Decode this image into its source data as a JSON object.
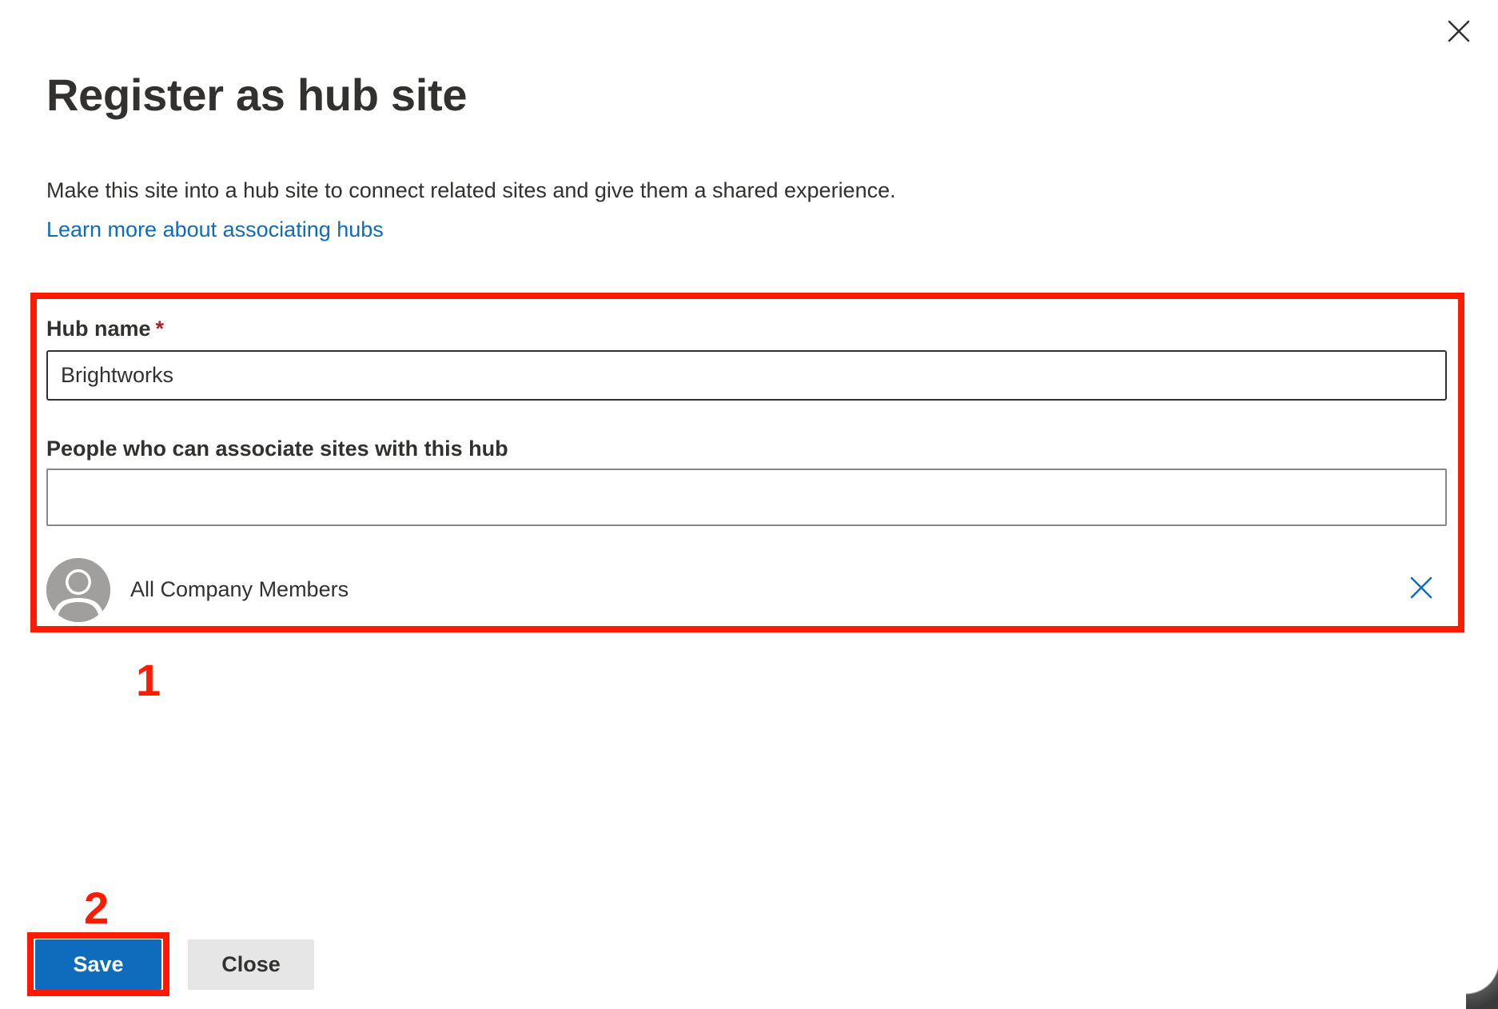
{
  "dialog": {
    "title": "Register as hub site",
    "description": "Make this site into a hub site to connect related sites and give them a shared experience.",
    "learn_more_link": "Learn more about associating hubs",
    "close_icon": "close-icon"
  },
  "form": {
    "hub_name": {
      "label": "Hub name",
      "required_marker": "*",
      "value": "Brightworks"
    },
    "people": {
      "label": "People who can associate sites with this hub",
      "value": "",
      "selected": [
        {
          "name": "All Company Members",
          "icon": "person-avatar-icon",
          "remove_icon": "remove-icon"
        }
      ]
    }
  },
  "footer": {
    "save_label": "Save",
    "close_label": "Close"
  },
  "annotations": {
    "step_1": "1",
    "step_2": "2",
    "highlight_color": "#ff1a00"
  },
  "colors": {
    "accent": "#0f6cbd",
    "text": "#323130",
    "required": "#a4262c"
  }
}
